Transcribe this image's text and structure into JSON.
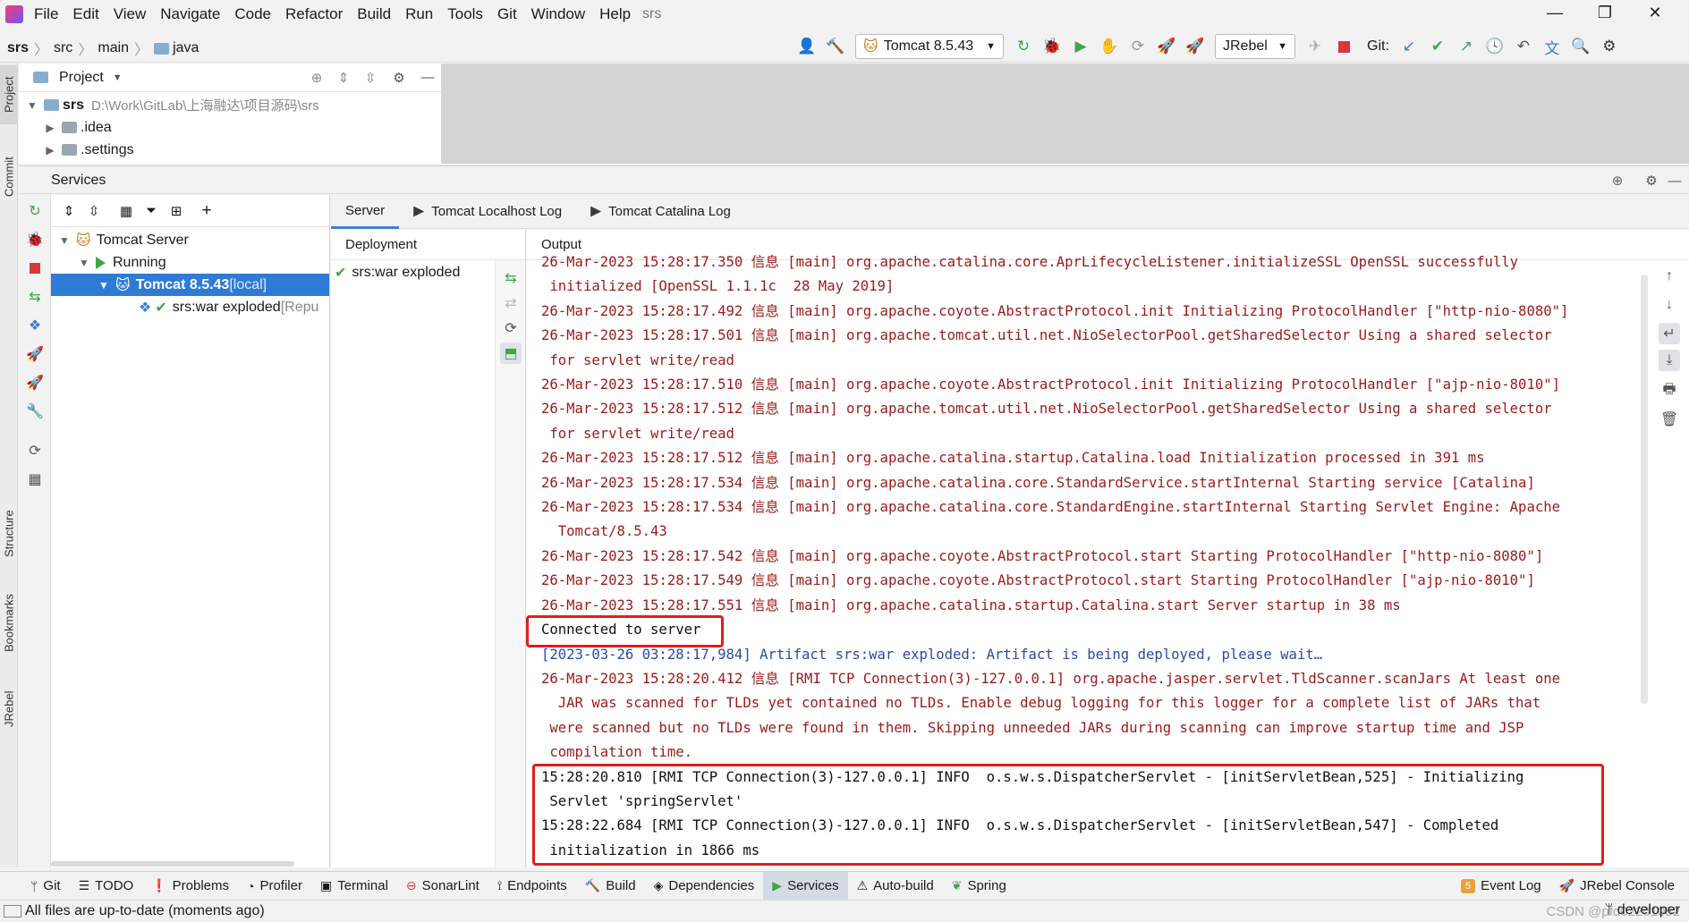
{
  "menubar": {
    "items": [
      "File",
      "Edit",
      "View",
      "Navigate",
      "Code",
      "Refactor",
      "Build",
      "Run",
      "Tools",
      "Git",
      "Window",
      "Help"
    ],
    "project_name": "srs",
    "window_controls": [
      "—",
      "❐",
      "✕"
    ]
  },
  "breadcrumb": [
    "srs",
    "src",
    "main",
    "java"
  ],
  "toolbar": {
    "run_config": "Tomcat 8.5.43",
    "jrebel_config": "JRebel",
    "git_label": "Git:"
  },
  "left_strip": {
    "tabs": [
      "Project",
      "Commit",
      "Structure",
      "Bookmarks",
      "JRebel"
    ]
  },
  "project_panel": {
    "title": "Project",
    "tree": [
      {
        "name": "srs",
        "path": "D:\\Work\\GitLab\\上海融达\\项目源码\\srs",
        "expanded": true
      },
      {
        "name": ".idea",
        "expanded": false
      },
      {
        "name": ".settings",
        "expanded": false
      }
    ]
  },
  "services": {
    "title": "Services",
    "tree": [
      {
        "label": "Tomcat Server",
        "suffix": ""
      },
      {
        "label": "Running",
        "suffix": ""
      },
      {
        "label": "Tomcat 8.5.43",
        "suffix": " [local]"
      },
      {
        "label": "srs:war exploded",
        "suffix": " [Repu"
      }
    ],
    "detail_tabs": [
      "Server",
      "Tomcat Localhost Log",
      "Tomcat Catalina Log"
    ],
    "deployment_header": "Deployment",
    "deployment_item": "srs:war exploded",
    "output_header": "Output"
  },
  "console": {
    "lines": [
      {
        "text": "26-Mar-2023 15:28:17.350 信息 [main] org.apache.catalina.core.AprLifecycleListener.initializeSSL OpenSSL successfully",
        "color": "red"
      },
      {
        "text": " initialized [OpenSSL 1.1.1c  28 May 2019]",
        "color": "red"
      },
      {
        "text": "26-Mar-2023 15:28:17.492 信息 [main] org.apache.coyote.AbstractProtocol.init Initializing ProtocolHandler [\"http-nio-8080\"]",
        "color": "red"
      },
      {
        "text": "26-Mar-2023 15:28:17.501 信息 [main] org.apache.tomcat.util.net.NioSelectorPool.getSharedSelector Using a shared selector",
        "color": "red"
      },
      {
        "text": " for servlet write/read",
        "color": "red"
      },
      {
        "text": "26-Mar-2023 15:28:17.510 信息 [main] org.apache.coyote.AbstractProtocol.init Initializing ProtocolHandler [\"ajp-nio-8010\"]",
        "color": "red"
      },
      {
        "text": "26-Mar-2023 15:28:17.512 信息 [main] org.apache.tomcat.util.net.NioSelectorPool.getSharedSelector Using a shared selector",
        "color": "red"
      },
      {
        "text": " for servlet write/read",
        "color": "red"
      },
      {
        "text": "26-Mar-2023 15:28:17.512 信息 [main] org.apache.catalina.startup.Catalina.load Initialization processed in 391 ms",
        "color": "red"
      },
      {
        "text": "26-Mar-2023 15:28:17.534 信息 [main] org.apache.catalina.core.StandardService.startInternal Starting service [Catalina]",
        "color": "red"
      },
      {
        "text": "26-Mar-2023 15:28:17.534 信息 [main] org.apache.catalina.core.StandardEngine.startInternal Starting Servlet Engine: Apache",
        "color": "red"
      },
      {
        "text": "  Tomcat/8.5.43",
        "color": "red"
      },
      {
        "text": "26-Mar-2023 15:28:17.542 信息 [main] org.apache.coyote.AbstractProtocol.start Starting ProtocolHandler [\"http-nio-8080\"]",
        "color": "red"
      },
      {
        "text": "26-Mar-2023 15:28:17.549 信息 [main] org.apache.coyote.AbstractProtocol.start Starting ProtocolHandler [\"ajp-nio-8010\"]",
        "color": "red"
      },
      {
        "text": "26-Mar-2023 15:28:17.551 信息 [main] org.apache.catalina.startup.Catalina.start Server startup in 38 ms",
        "color": "red"
      },
      {
        "text": "Connected to server",
        "color": "black"
      },
      {
        "text": "[2023-03-26 03:28:17,984] Artifact srs:war exploded: Artifact is being deployed, please wait…",
        "color": "blue"
      },
      {
        "text": "26-Mar-2023 15:28:20.412 信息 [RMI TCP Connection(3)-127.0.0.1] org.apache.jasper.servlet.TldScanner.scanJars At least one",
        "color": "red"
      },
      {
        "text": "  JAR was scanned for TLDs yet contained no TLDs. Enable debug logging for this logger for a complete list of JARs that",
        "color": "red"
      },
      {
        "text": " were scanned but no TLDs were found in them. Skipping unneeded JARs during scanning can improve startup time and JSP",
        "color": "red"
      },
      {
        "text": " compilation time.",
        "color": "red"
      },
      {
        "text": "15:28:20.810 [RMI TCP Connection(3)-127.0.0.1] INFO  o.s.w.s.DispatcherServlet - [initServletBean,525] - Initializing",
        "color": "black"
      },
      {
        "text": " Servlet 'springServlet'",
        "color": "black"
      },
      {
        "text": "15:28:22.684 [RMI TCP Connection(3)-127.0.0.1] INFO  o.s.w.s.DispatcherServlet - [initServletBean,547] - Completed",
        "color": "black"
      },
      {
        "text": " initialization in 1866 ms",
        "color": "black"
      }
    ]
  },
  "bottom_tabs": [
    "Git",
    "TODO",
    "Problems",
    "Profiler",
    "Terminal",
    "SonarLint",
    "Endpoints",
    "Build",
    "Dependencies",
    "Services",
    "Auto-build",
    "Spring"
  ],
  "bottom_right": {
    "event_log_count": "5",
    "event_log": "Event Log",
    "jrebel_console": "JRebel Console"
  },
  "status": {
    "message": "All files are up-to-date (moments ago)",
    "branch": "developer",
    "watermark": "CSDN @pfd02201082"
  },
  "colors": {
    "selection": "#2e7bd6",
    "log_red": "#9b1a1a",
    "log_blue": "#2b4aa8",
    "highlight": "#e31c1c"
  }
}
